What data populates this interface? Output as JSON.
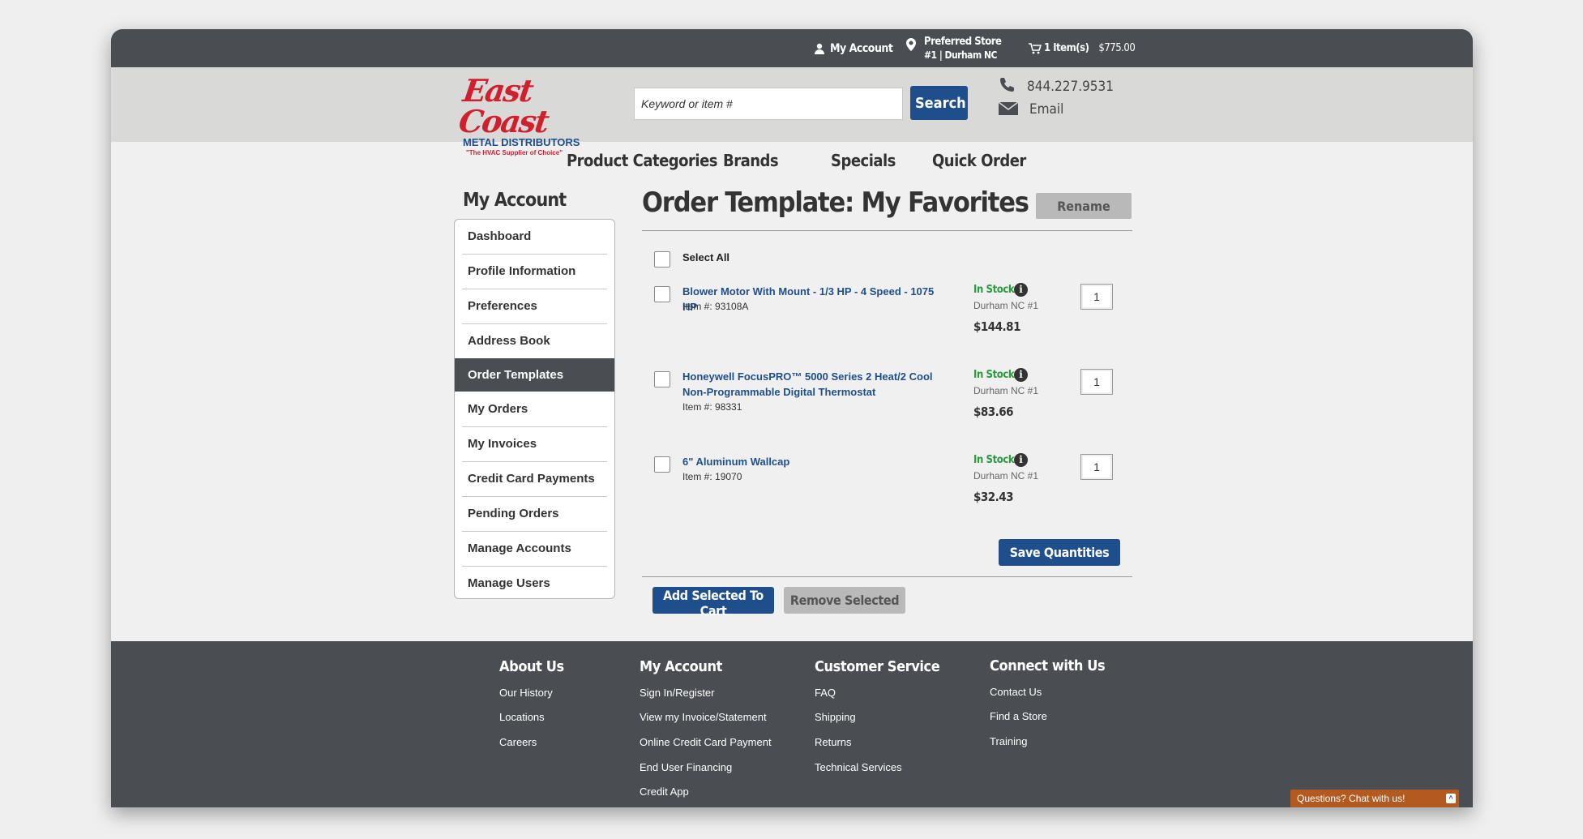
{
  "topbar": {
    "account_label": "My Account",
    "store_line1": "Preferred Store",
    "store_line2": "#1 | Durham NC",
    "cart_label": "1 Item(s)",
    "cart_total": "$775.00"
  },
  "header": {
    "logo_line1": "East Coast",
    "logo_line2": "METAL DISTRIBUTORS",
    "logo_tagline": "\"The HVAC Supplier of Choice\"",
    "search_placeholder": "Keyword or item #",
    "search_button": "Search",
    "phone": "844.227.9531",
    "email_label": "Email"
  },
  "nav": {
    "items": [
      "Product Categories",
      "Brands",
      "Specials",
      "Quick Order"
    ]
  },
  "sidebar": {
    "title": "My Account",
    "items": [
      "Dashboard",
      "Profile Information",
      "Preferences",
      "Address Book",
      "Order Templates",
      "My Orders",
      "My Invoices",
      "Credit Card Payments",
      "Pending Orders",
      "Manage Accounts",
      "Manage Users"
    ],
    "active": "Order Templates"
  },
  "main": {
    "title": "Order Template: My Favorites",
    "rename_button": "Rename",
    "select_all_label": "Select All",
    "items": [
      {
        "name_line1": "Blower Motor With Mount - 1/3 HP - 4 Speed - 1075 HP",
        "name_line2": "",
        "item_number": "Item #: 93108A",
        "stock": "In Stock",
        "store": "Durham NC #1",
        "price": "$144.81",
        "qty": "1"
      },
      {
        "name_line1": "Honeywell FocusPRO™ 5000 Series 2 Heat/2 Cool",
        "name_line2": "Non-Programmable Digital Thermostat",
        "item_number": "Item #: 98331",
        "stock": "In Stock",
        "store": "Durham NC #1",
        "price": "$83.66",
        "qty": "1"
      },
      {
        "name_line1": "6\" Aluminum Wallcap",
        "name_line2": "",
        "item_number": "Item #: 19070",
        "stock": "In Stock",
        "store": "Durham NC #1",
        "price": "$32.43",
        "qty": "1"
      }
    ],
    "save_quantities_button": "Save Quantities",
    "add_selected_button": "Add Selected To Cart",
    "remove_selected_button": "Remove Selected"
  },
  "footer": {
    "columns": [
      {
        "heading": "About Us",
        "links": [
          "Our History",
          "Locations",
          "Careers"
        ]
      },
      {
        "heading": "My Account",
        "links": [
          "Sign In/Register",
          "View my Invoice/Statement",
          "Online Credit Card Payment",
          "End User Financing",
          "Credit App"
        ]
      },
      {
        "heading": "Customer Service",
        "links": [
          "FAQ",
          "Shipping",
          "Returns",
          "Technical Services"
        ]
      },
      {
        "heading": "Connect with Us",
        "links": [
          "Contact Us",
          "Find a Store",
          "Training"
        ]
      }
    ]
  },
  "chat": {
    "label": "Questions? Chat with us!"
  },
  "colors": {
    "brand_blue": "#1f4e8c",
    "brand_red": "#d0202e",
    "dark_bar": "#4a4d51",
    "in_stock": "#2b9a3e",
    "chat": "#b35a21"
  }
}
